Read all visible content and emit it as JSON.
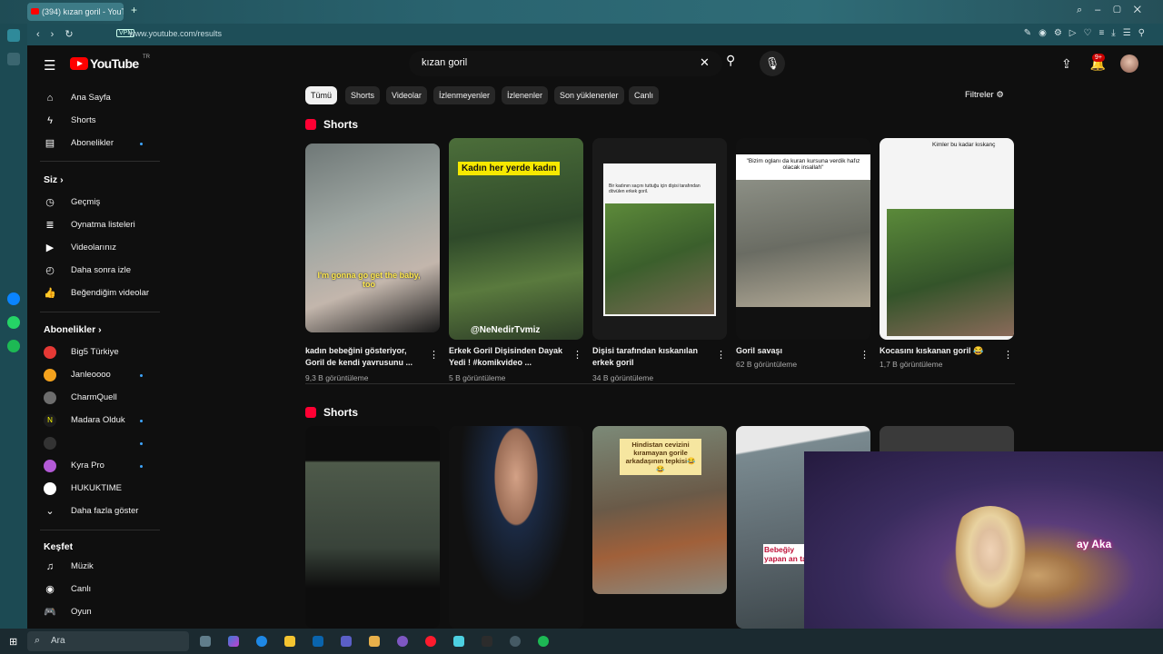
{
  "browser": {
    "tab_title": "(394) kızan goril - YouTube",
    "url": "www.youtube.com/results",
    "vpn_label": "VPN"
  },
  "youtube": {
    "logo_text": "YouTube",
    "logo_region": "TR",
    "search_query": "kızan goril",
    "notification_count": "9+"
  },
  "sidebar": {
    "main": [
      "Ana Sayfa",
      "Shorts",
      "Abonelikler"
    ],
    "you_header": "Siz",
    "you_items": [
      "Geçmiş",
      "Oynatma listeleri",
      "Videolarınız",
      "Daha sonra izle",
      "Beğendiğim videolar"
    ],
    "subs_header": "Abonelikler",
    "subs": [
      {
        "name": "Big5 Türkiye",
        "color": "#e53935",
        "dot": false
      },
      {
        "name": "Janleoooo",
        "color": "#f4a21d",
        "dot": true
      },
      {
        "name": "CharmQuell",
        "color": "#6d6d6d",
        "dot": false
      },
      {
        "name": "Madara Olduk",
        "color": "#1c1c1c",
        "dot": true
      },
      {
        "name": "",
        "color": "#333333",
        "dot": true
      },
      {
        "name": "Kyra Pro",
        "color": "#b35ad6",
        "dot": true
      },
      {
        "name": "HUKUKTIME",
        "color": "#ffffff",
        "dot": false
      }
    ],
    "more": "Daha fazla göster",
    "explore_header": "Keşfet",
    "explore_items": [
      "Müzik",
      "Canlı",
      "Oyun"
    ]
  },
  "chips": [
    "Tümü",
    "Shorts",
    "Videolar",
    "İzlenmeyenler",
    "İzlenenler",
    "Son yüklenenler",
    "Canlı"
  ],
  "filters_label": "Filtreler",
  "shelf1": {
    "title": "Shorts",
    "items": [
      {
        "title": "kadın bebeğini gösteriyor, Goril de kendi yavrusunu ...",
        "views": "9,3 B görüntüleme",
        "caption": "I'm gonna go get the baby, too"
      },
      {
        "title": "Erkek Goril Dişisinden Dayak Yedi ! #komikvideo ...",
        "views": "5 B görüntüleme",
        "caption": "Kadın her yerde kadın",
        "caption2": "@NeNedirTvmiz"
      },
      {
        "title": "Dişisi tarafından kıskanılan erkek goril",
        "views": "34 B görüntüleme",
        "caption": "Bir kadının saçını tuttuğu için dişisi tarafından dövülen erkek goril."
      },
      {
        "title": "Goril savaşı",
        "views": "62 B görüntüleme",
        "caption": "\"Bizim oglanı da kuran kursuna verdik hafız olacak insallah\""
      },
      {
        "title": "Kocasını kıskanan goril 😂",
        "views": "1,7 B görüntüleme",
        "caption": "Kimler bu kadar kıskanç"
      }
    ]
  },
  "shelf2": {
    "title": "Shorts",
    "items": [
      {
        "caption": ""
      },
      {
        "caption": ""
      },
      {
        "caption": "Hindistan cevizini kıramayan gorile arkadaşının tepkisi😂😂"
      },
      {
        "caption": "Bebeğiy yapan an tavı"
      },
      {
        "caption": ""
      }
    ]
  },
  "webcam_label": "ay Aka",
  "taskbar": {
    "search_label": "Ara"
  }
}
